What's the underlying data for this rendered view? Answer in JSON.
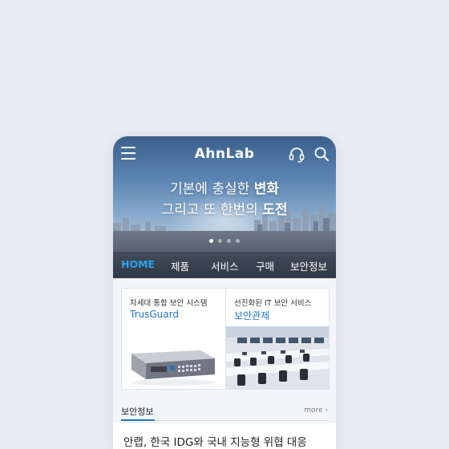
{
  "header": {
    "logo": "AhnLab",
    "menu_icon": "hamburger-menu-icon",
    "support_icon": "headset-icon",
    "search_icon": "search-icon"
  },
  "hero": {
    "line1": "기본에 충실한 ",
    "line1_bold": "변화",
    "line2": "그리고 또 한번의 ",
    "line2_bold": "도전",
    "slides_total": 4,
    "slide_active": 1
  },
  "nav": {
    "items": [
      "HOME",
      "제품",
      "서비스",
      "구매",
      "보안정보"
    ],
    "active": "HOME"
  },
  "cards": [
    {
      "title": "차세대 통합 보안 시스템",
      "subtitle": "TrusGuard",
      "image": "network-appliance-image"
    },
    {
      "title": "선진화된 IT 보안 서비스",
      "subtitle": "보안관제",
      "image": "control-room-image"
    }
  ],
  "section": {
    "title": "보안정보",
    "more": "more ›"
  },
  "news": {
    "headline": "안랩, 한국 IDG와 국내 지능형 위협 대응"
  },
  "colors": {
    "accent": "#2176c7",
    "nav_active": "#2aa3ef",
    "background": "#e9ebf1"
  }
}
